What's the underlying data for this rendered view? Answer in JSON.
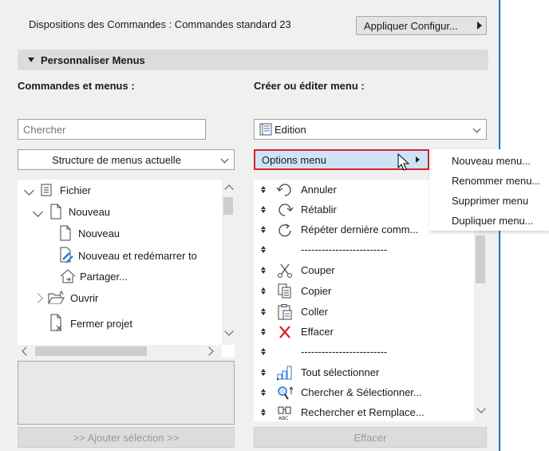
{
  "header": {
    "layout_text": "Dispositions des Commandes : Commandes standard 23",
    "apply_button": "Appliquer Configur..."
  },
  "section": {
    "title": "Personnaliser Menus"
  },
  "left": {
    "label": "Commandes et menus :",
    "search_placeholder": "Chercher",
    "structure_select": "Structure de menus actuelle",
    "tree": [
      {
        "label": "Fichier",
        "icon": "folder-list-icon",
        "expander": "expanded"
      },
      {
        "label": "Nouveau",
        "icon": "document-icon",
        "expander": "expanded"
      },
      {
        "label": "Nouveau",
        "icon": "document-icon",
        "expander": "none"
      },
      {
        "label": "Nouveau et redémarrer to",
        "icon": "document-restart-icon",
        "expander": "none"
      },
      {
        "label": "Partager...",
        "icon": "share-house-icon",
        "expander": "none"
      },
      {
        "label": "Ouvrir",
        "icon": "open-folder-icon",
        "expander": "collapsed"
      },
      {
        "label": "Fermer projet",
        "icon": "close-document-icon",
        "expander": "none"
      }
    ],
    "add_button": ">> Ajouter sélection >>"
  },
  "right": {
    "label": "Créer ou éditer menu :",
    "menu_select": "Edition",
    "options_button": "Options menu",
    "menu_items": [
      {
        "label": "Annuler",
        "icon": "undo-icon"
      },
      {
        "label": "Rétablir",
        "icon": "redo-icon"
      },
      {
        "label": "Répéter dernière comm...",
        "icon": "repeat-icon"
      },
      {
        "label": "-------------------------",
        "icon": ""
      },
      {
        "label": "Couper",
        "icon": "cut-icon"
      },
      {
        "label": "Copier",
        "icon": "copy-icon"
      },
      {
        "label": "Coller",
        "icon": "paste-icon"
      },
      {
        "label": "Effacer",
        "icon": "delete-x-icon"
      },
      {
        "label": "-------------------------",
        "icon": ""
      },
      {
        "label": "Tout sélectionner",
        "icon": "select-all-icon"
      },
      {
        "label": "Chercher & Sélectionner...",
        "icon": "find-select-icon"
      },
      {
        "label": "Rechercher et Remplace...",
        "icon": "find-replace-icon"
      }
    ],
    "delete_button": "Effacer"
  },
  "popup_menu": [
    "Nouveau menu...",
    "Renommer menu...",
    "Supprimer menu",
    "Dupliquer menu..."
  ],
  "colors": {
    "highlight": "#cfe3f7",
    "focus_border": "#d9232e",
    "accent_line": "#2f6fcf",
    "delete_x": "#e02020"
  }
}
